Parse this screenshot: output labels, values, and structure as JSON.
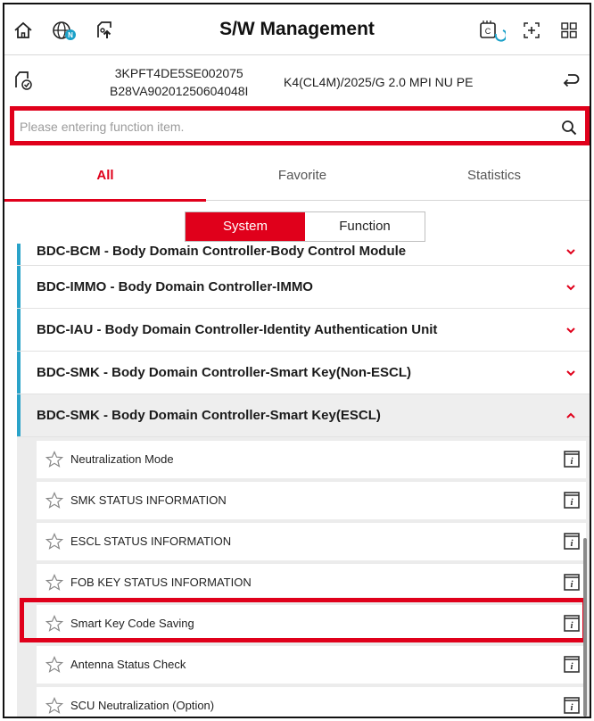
{
  "header": {
    "title": "S/W Management"
  },
  "vehicle": {
    "vin": "3KPFT4DE5SE002075",
    "code": "B28VA90201250604048I",
    "model": "K4(CL4M)/2025/G 2.0 MPI NU PE"
  },
  "search": {
    "placeholder": "Please entering function item."
  },
  "tabs": [
    {
      "label": "All",
      "active": true
    },
    {
      "label": "Favorite",
      "active": false
    },
    {
      "label": "Statistics",
      "active": false
    }
  ],
  "segment": {
    "system_label": "System",
    "function_label": "Function",
    "active": "System"
  },
  "groups": [
    {
      "label": "BDC-BCM - Body Domain Controller-Body Control Module",
      "expanded": false
    },
    {
      "label": "BDC-IMMO - Body Domain Controller-IMMO",
      "expanded": false
    },
    {
      "label": "BDC-IAU - Body Domain Controller-Identity Authentication Unit",
      "expanded": false
    },
    {
      "label": "BDC-SMK - Body Domain Controller-Smart Key(Non-ESCL)",
      "expanded": false
    },
    {
      "label": "BDC-SMK - Body Domain Controller-Smart Key(ESCL)",
      "expanded": true
    }
  ],
  "items": [
    {
      "label": "Neutralization Mode"
    },
    {
      "label": "SMK STATUS INFORMATION"
    },
    {
      "label": "ESCL STATUS INFORMATION"
    },
    {
      "label": "FOB KEY STATUS INFORMATION"
    },
    {
      "label": "Smart Key Code Saving",
      "highlighted": true
    },
    {
      "label": "Antenna Status Check"
    },
    {
      "label": "SCU Neutralization (Option)"
    }
  ],
  "colors": {
    "accent": "#e0001b",
    "group_bar": "#2aa3c9",
    "highlight": "#e0001b"
  }
}
